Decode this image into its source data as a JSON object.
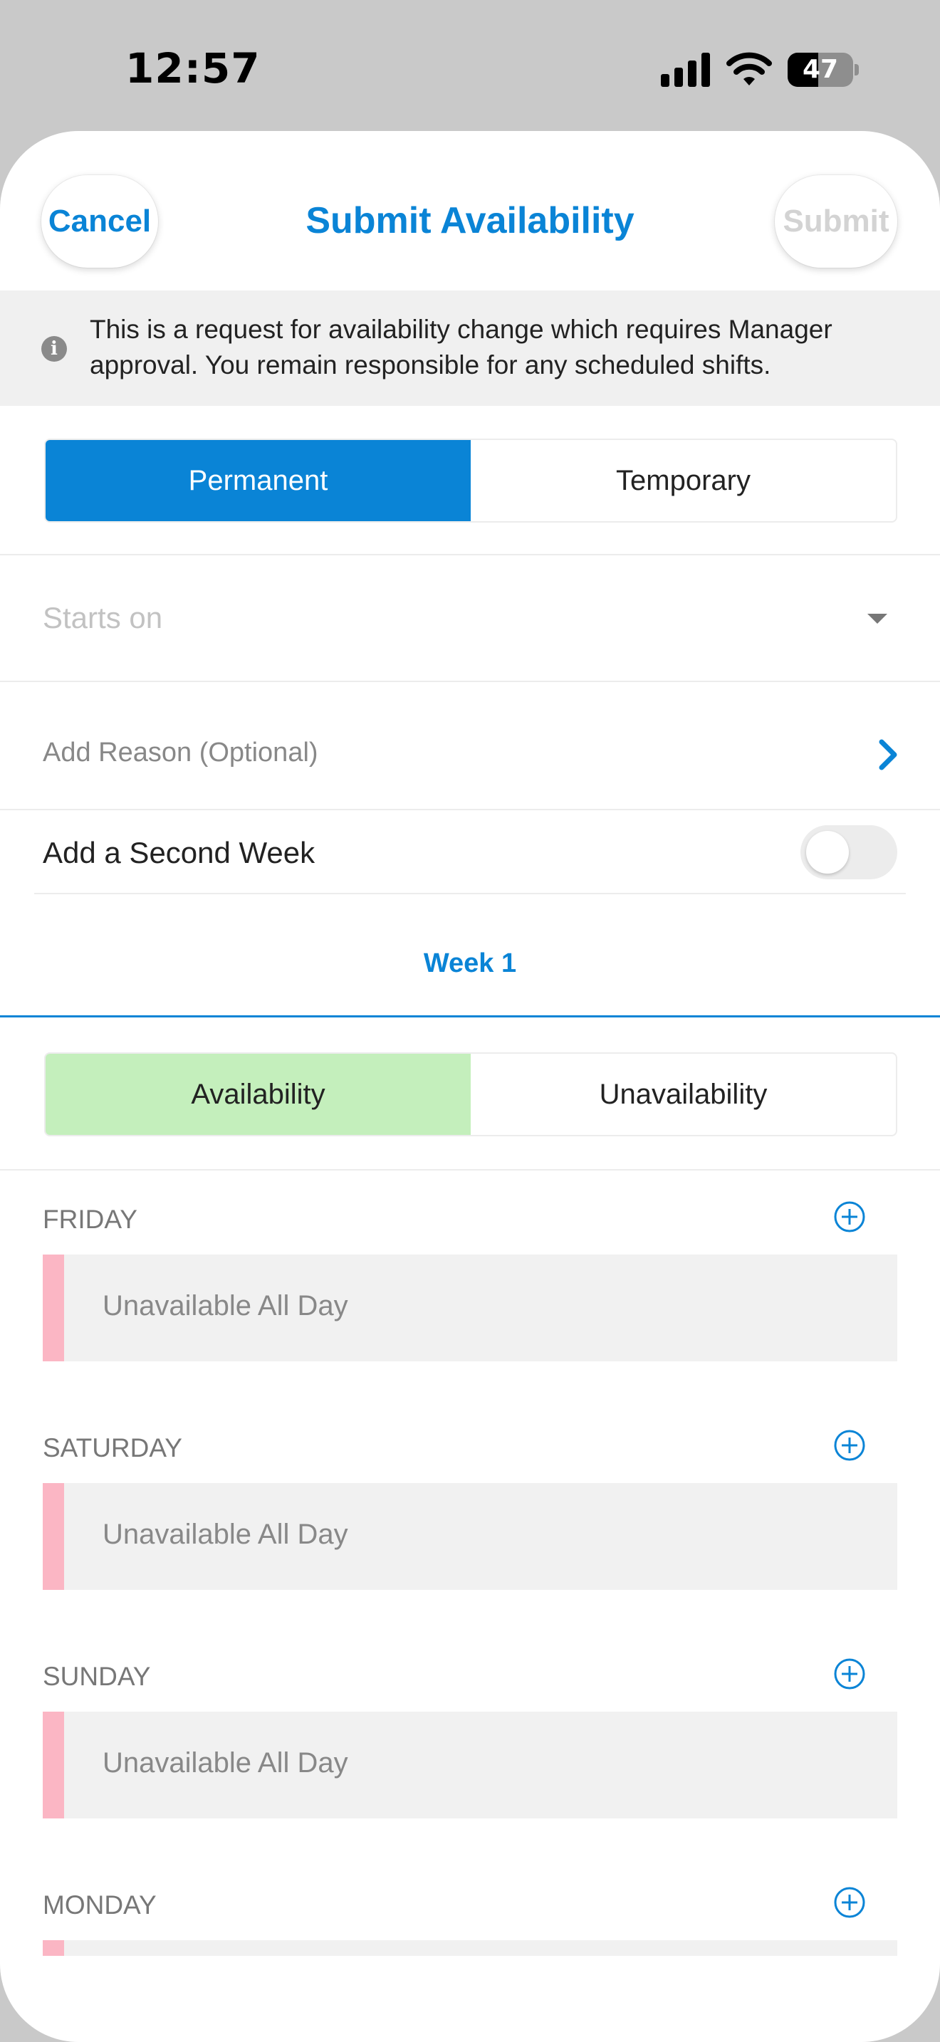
{
  "status_bar": {
    "time": "12:57",
    "battery": "47",
    "battery_level": 0.47,
    "icons": [
      "signal-icon",
      "wifi-icon",
      "battery-icon"
    ]
  },
  "nav": {
    "cancel": "Cancel",
    "title": "Submit Availability",
    "submit": "Submit"
  },
  "notice": {
    "text": "This is a request for availability change which requires Manager approval. You remain responsible for any scheduled shifts.",
    "icon": "info-icon"
  },
  "type_segment": {
    "options": [
      "Permanent",
      "Temporary"
    ],
    "selected": "Permanent"
  },
  "starts_on": {
    "placeholder": "Starts on",
    "icon": "caret-down-icon"
  },
  "reason": {
    "label": "Add Reason (Optional)",
    "icon": "chevron-right-icon"
  },
  "second_week": {
    "label": "Add a Second Week",
    "enabled": false
  },
  "week_tab": "Week 1",
  "avail_segment": {
    "options": [
      "Availability",
      "Unavailability"
    ],
    "selected": "Availability"
  },
  "days": [
    {
      "name": "FRIDAY",
      "slot": "Unavailable All Day"
    },
    {
      "name": "SATURDAY",
      "slot": "Unavailable All Day"
    },
    {
      "name": "SUNDAY",
      "slot": "Unavailable All Day"
    },
    {
      "name": "MONDAY",
      "slot": ""
    }
  ],
  "colors": {
    "accent": "#0a84d6",
    "availability_selected": "#c4efbc",
    "unavailable_marker": "#fbb6c4"
  }
}
